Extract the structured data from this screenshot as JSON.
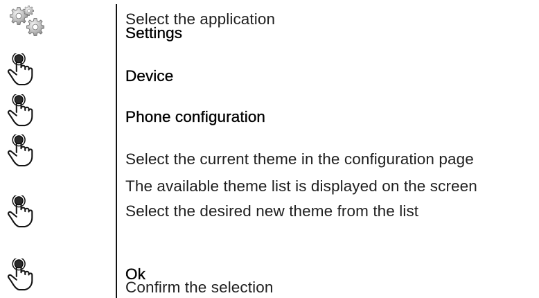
{
  "steps": {
    "select_app": "Select the application",
    "settings": "Settings",
    "device": "Device",
    "phone_configuration": "Phone configuration",
    "select_current_theme": "Select the current theme in the configuration page",
    "theme_list_displayed": "The available theme list is displayed on the screen",
    "select_new_theme": "Select the desired new theme from the list",
    "ok": "Ok",
    "confirm_selection": "Confirm the selection"
  },
  "icons": {
    "settings": "settings-gears-icon",
    "tap": "hand-tap-icon"
  }
}
